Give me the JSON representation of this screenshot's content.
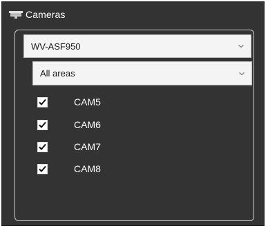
{
  "panel": {
    "title": "Cameras",
    "icon": "camera-icon"
  },
  "camera_select": {
    "value": "WV-ASF950",
    "icon": "chevron-down-icon"
  },
  "area_select": {
    "value": "All areas",
    "icon": "chevron-down-icon"
  },
  "cameras": [
    {
      "label": "CAM5",
      "checked": true
    },
    {
      "label": "CAM6",
      "checked": true
    },
    {
      "label": "CAM7",
      "checked": true
    },
    {
      "label": "CAM8",
      "checked": true
    }
  ],
  "colors": {
    "panel_bg": "#333333",
    "frame_border": "#cfcfcf",
    "dropdown_bg": "#f4f4f4",
    "text_light": "#ffffff",
    "text_dark": "#1a1a1a"
  }
}
